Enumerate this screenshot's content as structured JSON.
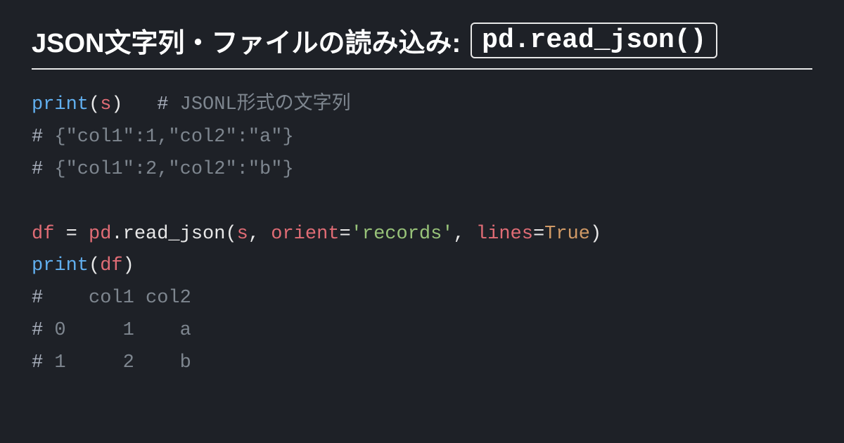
{
  "header": {
    "title_text": "JSON文字列・ファイルの読み込み:",
    "title_code": "pd.read_json()"
  },
  "code": {
    "line1": {
      "print": "print",
      "open": "(",
      "var": "s",
      "close": ")",
      "pad": "   ",
      "hash": "#",
      "comment": " JSONL形式の文字列"
    },
    "line2": {
      "hash": "#",
      "text": " {\"col1\":1,\"col2\":\"a\"}"
    },
    "line3": {
      "hash": "#",
      "text": " {\"col1\":2,\"col2\":\"b\"}"
    },
    "line4": {
      "df": "df",
      "eq": " = ",
      "pd": "pd",
      "dot": ".",
      "fn": "read_json",
      "open": "(",
      "s": "s",
      "c1": ", ",
      "kw1": "orient",
      "eq1": "=",
      "str": "'records'",
      "c2": ", ",
      "kw2": "lines",
      "eq2": "=",
      "true": "True",
      "close": ")"
    },
    "line5": {
      "print": "print",
      "open": "(",
      "var": "df",
      "close": ")"
    },
    "line6": {
      "hash": "#",
      "text": "    col1 col2"
    },
    "line7": {
      "hash": "#",
      "text": " 0     1    a"
    },
    "line8": {
      "hash": "#",
      "text": " 1     2    b"
    }
  }
}
